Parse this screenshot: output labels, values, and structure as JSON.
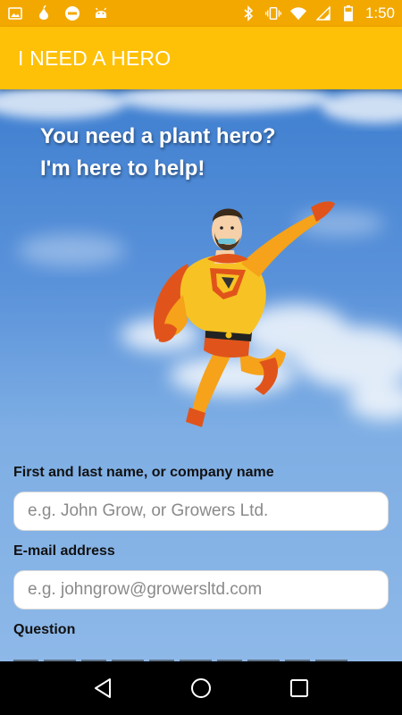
{
  "status_bar": {
    "time": "1:50",
    "left_icons": [
      "image-icon",
      "pear-icon",
      "blocked-icon",
      "android-icon"
    ],
    "right_icons": [
      "bluetooth-icon",
      "vibrate-icon",
      "wifi-icon",
      "signal-icon",
      "battery-icon"
    ]
  },
  "app_bar": {
    "title": "I NEED A HERO"
  },
  "hero": {
    "line1": "You need a plant hero?",
    "line2": "I'm here to help!"
  },
  "form": {
    "name_label": "First and last name, or company name",
    "name_placeholder": "e.g. John Grow, or Growers Ltd.",
    "email_label": "E-mail address",
    "email_placeholder": "e.g. johngrow@growersltd.com",
    "question_label": "Question"
  },
  "colors": {
    "status_bar": "#f3a800",
    "app_bar": "#ffc107",
    "sky": "#5b93da"
  }
}
